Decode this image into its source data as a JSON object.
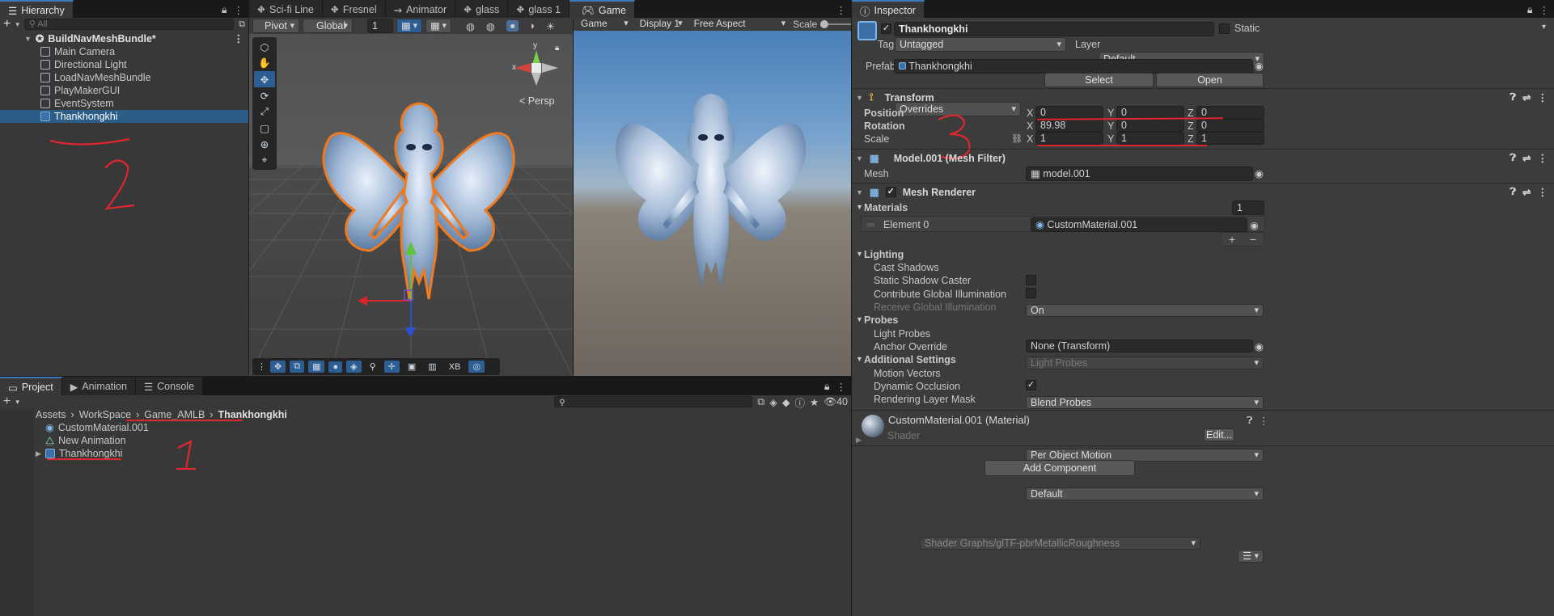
{
  "hierarchy": {
    "tab": "Hierarchy",
    "search_placeholder": "All",
    "root": "BuildNavMeshBundle*",
    "items": [
      "Main Camera",
      "Directional Light",
      "LoadNavMeshBundle",
      "PlayMakerGUI",
      "EventSystem",
      "Thankhongkhi"
    ],
    "selected": "Thankhongkhi"
  },
  "scene_tabs": [
    "Sci-fi Line",
    "Fresnel",
    "Animator",
    "glass",
    "glass 1"
  ],
  "scene_toolbar": {
    "pivot": "Pivot",
    "space": "Global",
    "snap_value": "1"
  },
  "gizmo": {
    "y": "y",
    "x": "x",
    "projection": "Persp"
  },
  "bottom_tools": {
    "xb": "XB"
  },
  "game": {
    "tab": "Game",
    "mode": "Game",
    "display": "Display 1",
    "aspect": "Free Aspect",
    "scale_label": "Scale"
  },
  "inspector": {
    "tab": "Inspector",
    "object_name": "Thankhongkhi",
    "static_label": "Static",
    "tag_label": "Tag",
    "tag_value": "Untagged",
    "layer_label": "Layer",
    "layer_value": "Default",
    "prefab_label": "Prefab",
    "prefab_value": "Thankhongkhi",
    "overrides": "Overrides",
    "select": "Select",
    "open": "Open",
    "transform": {
      "title": "Transform",
      "position_label": "Position",
      "rotation_label": "Rotation",
      "scale_label": "Scale",
      "position": {
        "x": "0",
        "y": "0",
        "z": "0"
      },
      "rotation": {
        "x": "89.98",
        "y": "0",
        "z": "0"
      },
      "scale": {
        "x": "1",
        "y": "1",
        "z": "1"
      },
      "axis_x": "X",
      "axis_y": "Y",
      "axis_z": "Z"
    },
    "mesh_filter": {
      "title": "Model.001 (Mesh Filter)",
      "mesh_label": "Mesh",
      "mesh_value": "model.001"
    },
    "mesh_renderer": {
      "title": "Mesh Renderer",
      "materials_label": "Materials",
      "materials_count": "1",
      "element_label": "Element 0",
      "element_value": "CustomMaterial.001",
      "lighting_label": "Lighting",
      "cast_shadows_label": "Cast Shadows",
      "cast_shadows_value": "On",
      "static_shadow_label": "Static Shadow Caster",
      "contribute_gi_label": "Contribute Global Illumination",
      "receive_gi_label": "Receive Global Illumination",
      "receive_gi_value": "Light Probes",
      "probes_label": "Probes",
      "light_probes_label": "Light Probes",
      "light_probes_value": "Blend Probes",
      "anchor_override_label": "Anchor Override",
      "anchor_override_value": "None (Transform)",
      "additional_label": "Additional Settings",
      "motion_vectors_label": "Motion Vectors",
      "motion_vectors_value": "Per Object Motion",
      "dynamic_occlusion_label": "Dynamic Occlusion",
      "rendering_layer_label": "Rendering Layer Mask",
      "rendering_layer_value": "Default"
    },
    "material": {
      "title": "CustomMaterial.001 (Material)",
      "shader_label": "Shader",
      "shader_value": "Shader Graphs/glTF-pbrMetallicRoughness",
      "edit": "Edit..."
    },
    "add_component": "Add Component"
  },
  "project": {
    "tabs": [
      "Project",
      "Animation",
      "Console"
    ],
    "breadcrumb": [
      "Assets",
      "WorkSpace",
      "Game_AMLB",
      "Thankhongkhi"
    ],
    "items": [
      "CustomMaterial.001",
      "New Animation",
      "Thankhongkhi"
    ],
    "count": "40"
  },
  "annotations": [
    "1",
    "2",
    "3"
  ],
  "colors": {
    "accent": "#3a79bb",
    "selection": "#2c5d87",
    "annotation": "#e0262e",
    "selection_outline": "#f07a1e"
  }
}
